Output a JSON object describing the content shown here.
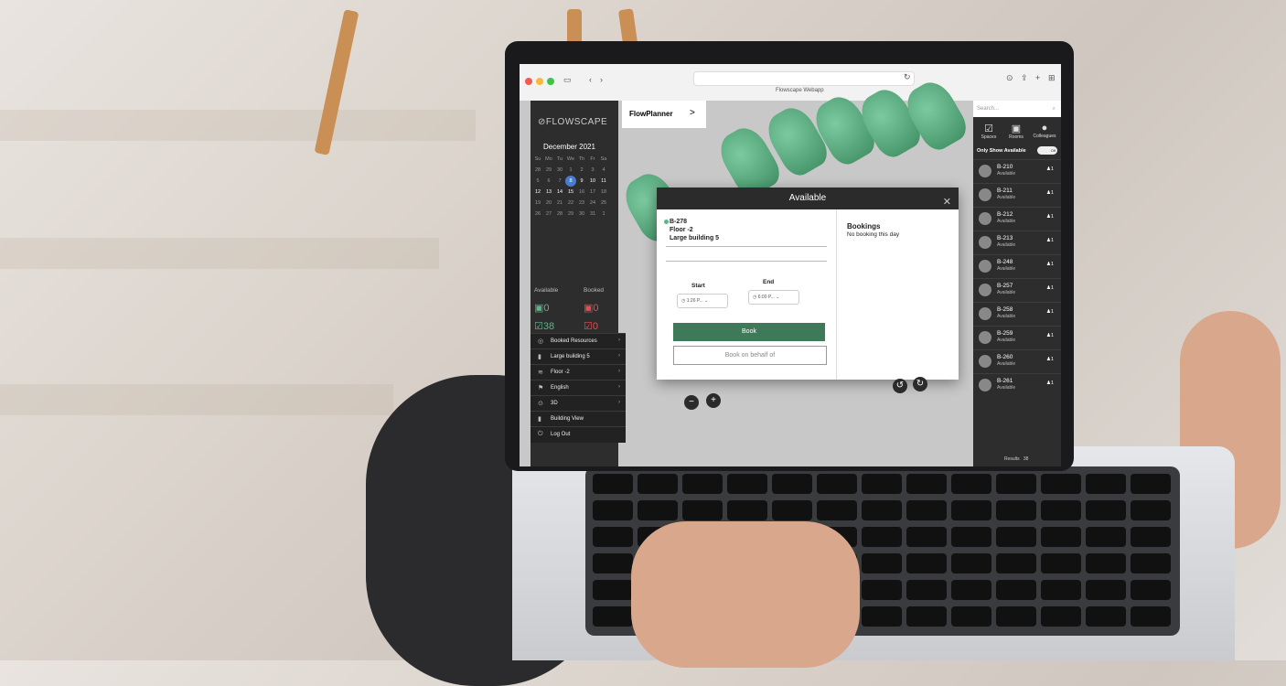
{
  "browser": {
    "site_title": "Flowscape Webapp",
    "url_reload": "↻"
  },
  "sidebar": {
    "logo": "⊘FLOWSCAPE",
    "month": "December 2021",
    "weekdays": [
      "Su",
      "Mo",
      "Tu",
      "We",
      "Th",
      "Fr",
      "Sa"
    ],
    "days": [
      "28",
      "29",
      "30",
      "1",
      "2",
      "3",
      "4",
      "5",
      "6",
      "7",
      "8",
      "9",
      "10",
      "11",
      "12",
      "13",
      "14",
      "15",
      "16",
      "17",
      "18",
      "19",
      "20",
      "21",
      "22",
      "23",
      "24",
      "25",
      "26",
      "27",
      "28",
      "29",
      "30",
      "31",
      "1"
    ],
    "selected_day": "8",
    "available_label": "Available",
    "booked_label": "Booked",
    "available_rooms": "0",
    "booked_rooms": "0",
    "available_spaces": "38",
    "booked_spaces": "0",
    "menu": [
      {
        "label": "Booked Resources",
        "icon": "◎"
      },
      {
        "label": "Large building 5",
        "icon": "▮"
      },
      {
        "label": "Floor -2",
        "icon": "≋"
      },
      {
        "label": "English",
        "icon": "⚑"
      },
      {
        "label": "3D",
        "icon": "⊙"
      },
      {
        "label": "Building View",
        "icon": "▮"
      },
      {
        "label": "Log Out",
        "icon": "⏻"
      }
    ]
  },
  "topbar": {
    "title": "FlowPlanner",
    "chevron": ">"
  },
  "modal": {
    "title": "Available",
    "resource_id": "B-278",
    "floor": "Floor -2",
    "building": "Large building 5",
    "start_label": "Start",
    "end_label": "End",
    "start_value": "1:26 P...",
    "end_value": "6:00 P...",
    "book_label": "Book",
    "behalf_label": "Book on behalf of",
    "bookings_title": "Bookings",
    "bookings_text": "No booking this day"
  },
  "right_panel": {
    "search_placeholder": "Search...",
    "tabs": [
      "Spaces",
      "Rooms",
      "Colleagues"
    ],
    "only_available_label": "Only Show Available",
    "toggle_label": "Off",
    "items": [
      {
        "name": "B-210",
        "status": "Available",
        "capacity": "1"
      },
      {
        "name": "B-211",
        "status": "Available",
        "capacity": "1"
      },
      {
        "name": "B-212",
        "status": "Available",
        "capacity": "1"
      },
      {
        "name": "B-213",
        "status": "Available",
        "capacity": "1"
      },
      {
        "name": "B-248",
        "status": "Available",
        "capacity": "1"
      },
      {
        "name": "B-257",
        "status": "Available",
        "capacity": "1"
      },
      {
        "name": "B-258",
        "status": "Available",
        "capacity": "1"
      },
      {
        "name": "B-259",
        "status": "Available",
        "capacity": "1"
      },
      {
        "name": "B-260",
        "status": "Available",
        "capacity": "1"
      },
      {
        "name": "B-261",
        "status": "Available",
        "capacity": "1"
      }
    ],
    "results_label": "Results",
    "results_count": "38"
  },
  "colors": {
    "accent_green": "#3e7a5a",
    "available_green": "#5bb58a",
    "booked_red": "#e05050",
    "selected_blue": "#4a7bd0"
  }
}
